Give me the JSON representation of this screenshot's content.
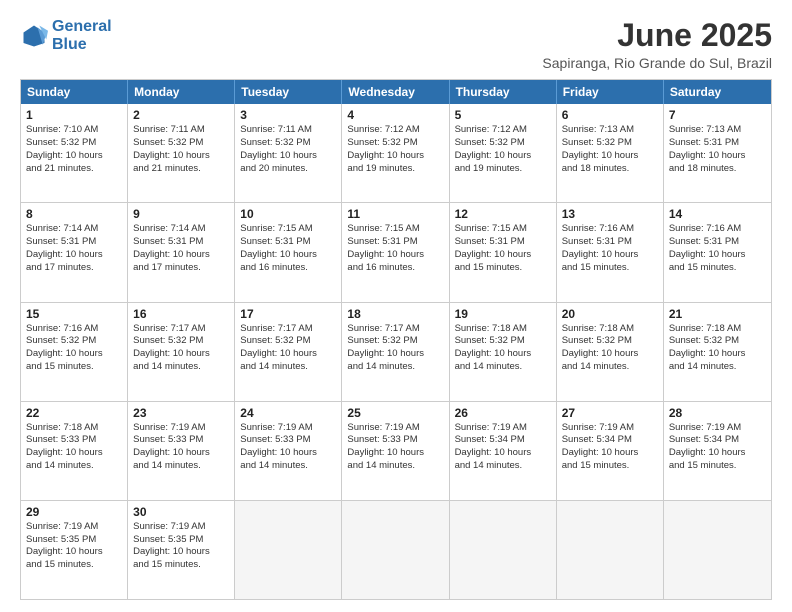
{
  "logo": {
    "line1": "General",
    "line2": "Blue"
  },
  "title": "June 2025",
  "subtitle": "Sapiranga, Rio Grande do Sul, Brazil",
  "header_days": [
    "Sunday",
    "Monday",
    "Tuesday",
    "Wednesday",
    "Thursday",
    "Friday",
    "Saturday"
  ],
  "rows": [
    [
      {
        "day": "1",
        "lines": [
          "Sunrise: 7:10 AM",
          "Sunset: 5:32 PM",
          "Daylight: 10 hours",
          "and 21 minutes."
        ]
      },
      {
        "day": "2",
        "lines": [
          "Sunrise: 7:11 AM",
          "Sunset: 5:32 PM",
          "Daylight: 10 hours",
          "and 21 minutes."
        ]
      },
      {
        "day": "3",
        "lines": [
          "Sunrise: 7:11 AM",
          "Sunset: 5:32 PM",
          "Daylight: 10 hours",
          "and 20 minutes."
        ]
      },
      {
        "day": "4",
        "lines": [
          "Sunrise: 7:12 AM",
          "Sunset: 5:32 PM",
          "Daylight: 10 hours",
          "and 19 minutes."
        ]
      },
      {
        "day": "5",
        "lines": [
          "Sunrise: 7:12 AM",
          "Sunset: 5:32 PM",
          "Daylight: 10 hours",
          "and 19 minutes."
        ]
      },
      {
        "day": "6",
        "lines": [
          "Sunrise: 7:13 AM",
          "Sunset: 5:32 PM",
          "Daylight: 10 hours",
          "and 18 minutes."
        ]
      },
      {
        "day": "7",
        "lines": [
          "Sunrise: 7:13 AM",
          "Sunset: 5:31 PM",
          "Daylight: 10 hours",
          "and 18 minutes."
        ]
      }
    ],
    [
      {
        "day": "8",
        "lines": [
          "Sunrise: 7:14 AM",
          "Sunset: 5:31 PM",
          "Daylight: 10 hours",
          "and 17 minutes."
        ]
      },
      {
        "day": "9",
        "lines": [
          "Sunrise: 7:14 AM",
          "Sunset: 5:31 PM",
          "Daylight: 10 hours",
          "and 17 minutes."
        ]
      },
      {
        "day": "10",
        "lines": [
          "Sunrise: 7:15 AM",
          "Sunset: 5:31 PM",
          "Daylight: 10 hours",
          "and 16 minutes."
        ]
      },
      {
        "day": "11",
        "lines": [
          "Sunrise: 7:15 AM",
          "Sunset: 5:31 PM",
          "Daylight: 10 hours",
          "and 16 minutes."
        ]
      },
      {
        "day": "12",
        "lines": [
          "Sunrise: 7:15 AM",
          "Sunset: 5:31 PM",
          "Daylight: 10 hours",
          "and 15 minutes."
        ]
      },
      {
        "day": "13",
        "lines": [
          "Sunrise: 7:16 AM",
          "Sunset: 5:31 PM",
          "Daylight: 10 hours",
          "and 15 minutes."
        ]
      },
      {
        "day": "14",
        "lines": [
          "Sunrise: 7:16 AM",
          "Sunset: 5:31 PM",
          "Daylight: 10 hours",
          "and 15 minutes."
        ]
      }
    ],
    [
      {
        "day": "15",
        "lines": [
          "Sunrise: 7:16 AM",
          "Sunset: 5:32 PM",
          "Daylight: 10 hours",
          "and 15 minutes."
        ]
      },
      {
        "day": "16",
        "lines": [
          "Sunrise: 7:17 AM",
          "Sunset: 5:32 PM",
          "Daylight: 10 hours",
          "and 14 minutes."
        ]
      },
      {
        "day": "17",
        "lines": [
          "Sunrise: 7:17 AM",
          "Sunset: 5:32 PM",
          "Daylight: 10 hours",
          "and 14 minutes."
        ]
      },
      {
        "day": "18",
        "lines": [
          "Sunrise: 7:17 AM",
          "Sunset: 5:32 PM",
          "Daylight: 10 hours",
          "and 14 minutes."
        ]
      },
      {
        "day": "19",
        "lines": [
          "Sunrise: 7:18 AM",
          "Sunset: 5:32 PM",
          "Daylight: 10 hours",
          "and 14 minutes."
        ]
      },
      {
        "day": "20",
        "lines": [
          "Sunrise: 7:18 AM",
          "Sunset: 5:32 PM",
          "Daylight: 10 hours",
          "and 14 minutes."
        ]
      },
      {
        "day": "21",
        "lines": [
          "Sunrise: 7:18 AM",
          "Sunset: 5:32 PM",
          "Daylight: 10 hours",
          "and 14 minutes."
        ]
      }
    ],
    [
      {
        "day": "22",
        "lines": [
          "Sunrise: 7:18 AM",
          "Sunset: 5:33 PM",
          "Daylight: 10 hours",
          "and 14 minutes."
        ]
      },
      {
        "day": "23",
        "lines": [
          "Sunrise: 7:19 AM",
          "Sunset: 5:33 PM",
          "Daylight: 10 hours",
          "and 14 minutes."
        ]
      },
      {
        "day": "24",
        "lines": [
          "Sunrise: 7:19 AM",
          "Sunset: 5:33 PM",
          "Daylight: 10 hours",
          "and 14 minutes."
        ]
      },
      {
        "day": "25",
        "lines": [
          "Sunrise: 7:19 AM",
          "Sunset: 5:33 PM",
          "Daylight: 10 hours",
          "and 14 minutes."
        ]
      },
      {
        "day": "26",
        "lines": [
          "Sunrise: 7:19 AM",
          "Sunset: 5:34 PM",
          "Daylight: 10 hours",
          "and 14 minutes."
        ]
      },
      {
        "day": "27",
        "lines": [
          "Sunrise: 7:19 AM",
          "Sunset: 5:34 PM",
          "Daylight: 10 hours",
          "and 15 minutes."
        ]
      },
      {
        "day": "28",
        "lines": [
          "Sunrise: 7:19 AM",
          "Sunset: 5:34 PM",
          "Daylight: 10 hours",
          "and 15 minutes."
        ]
      }
    ],
    [
      {
        "day": "29",
        "lines": [
          "Sunrise: 7:19 AM",
          "Sunset: 5:35 PM",
          "Daylight: 10 hours",
          "and 15 minutes."
        ]
      },
      {
        "day": "30",
        "lines": [
          "Sunrise: 7:19 AM",
          "Sunset: 5:35 PM",
          "Daylight: 10 hours",
          "and 15 minutes."
        ]
      },
      {
        "day": "",
        "lines": []
      },
      {
        "day": "",
        "lines": []
      },
      {
        "day": "",
        "lines": []
      },
      {
        "day": "",
        "lines": []
      },
      {
        "day": "",
        "lines": []
      }
    ]
  ]
}
